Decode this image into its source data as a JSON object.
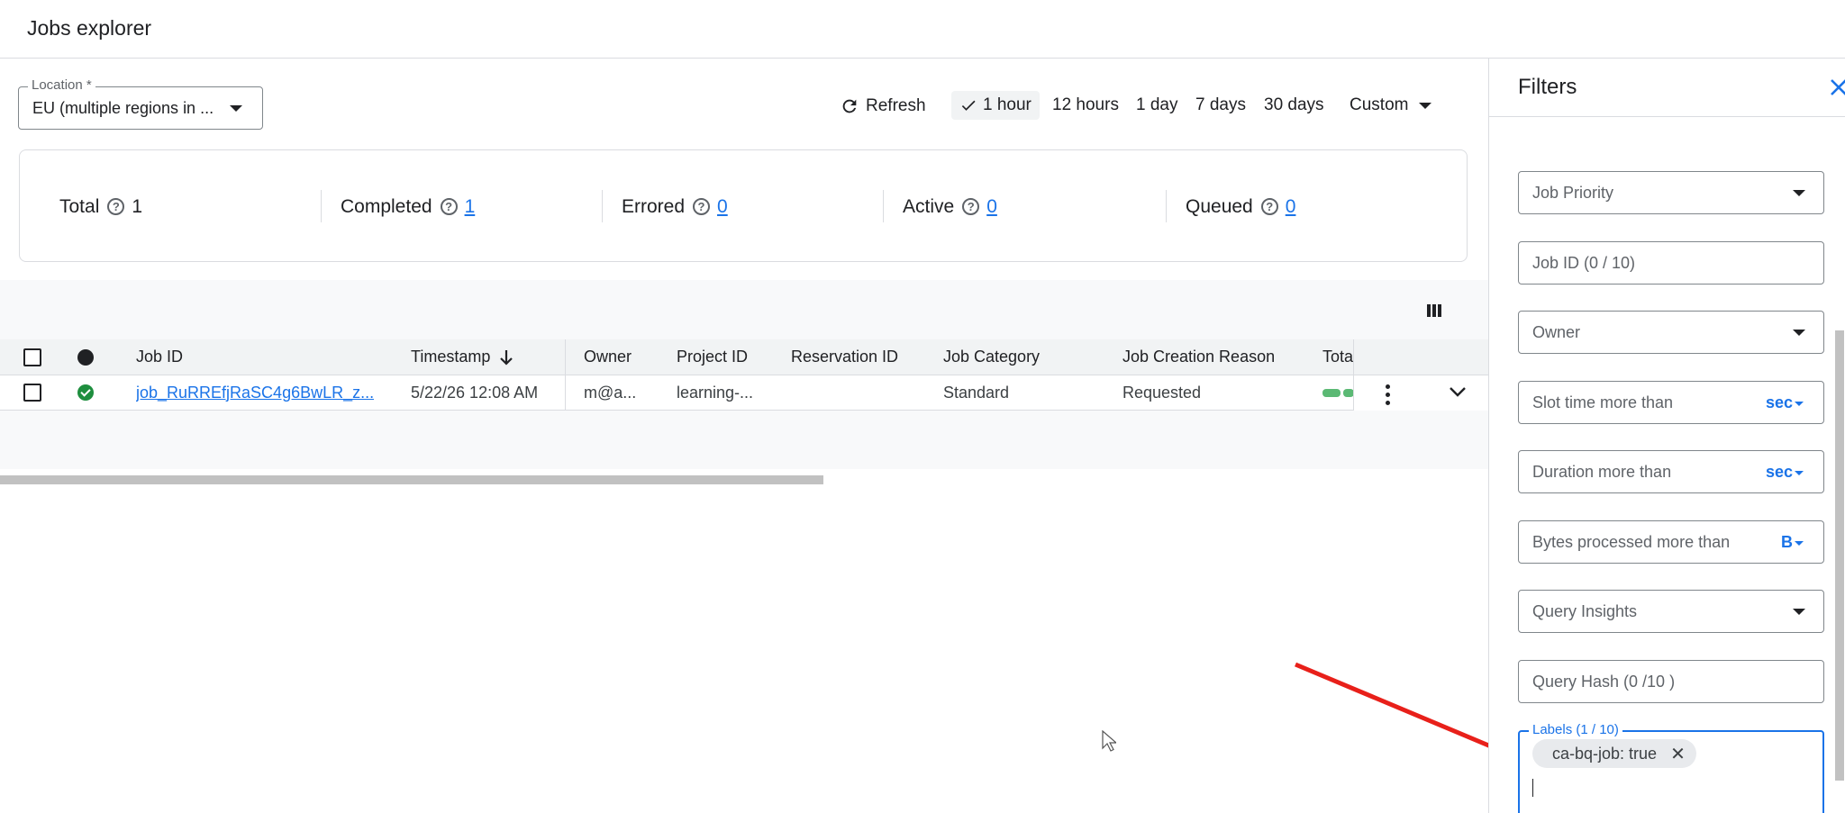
{
  "header": {
    "title": "Jobs explorer"
  },
  "toolbar": {
    "location_label": "Location *",
    "location_value": "EU (multiple regions in ...",
    "refresh_label": "Refresh",
    "ranges": [
      "1 hour",
      "12 hours",
      "1 day",
      "7 days",
      "30 days"
    ],
    "selected_range": "1 hour",
    "custom_label": "Custom"
  },
  "stats": {
    "total_label": "Total",
    "total_value": "1",
    "completed_label": "Completed",
    "completed_value": "1",
    "errored_label": "Errored",
    "errored_value": "0",
    "active_label": "Active",
    "active_value": "0",
    "queued_label": "Queued",
    "queued_value": "0"
  },
  "table": {
    "columns": [
      "Job ID",
      "Timestamp",
      "Owner",
      "Project ID",
      "Reservation ID",
      "Job Category",
      "Job Creation Reason",
      "Tota"
    ],
    "rows": [
      {
        "job_id": "job_RuRREfjRaSC4g6BwLR_z...",
        "timestamp": "5/22/26 12:08 AM",
        "owner": "m@a...",
        "project_id": "learning-...",
        "reservation_id": "",
        "job_category": "Standard",
        "job_creation_reason": "Requested"
      }
    ]
  },
  "filters": {
    "title": "Filters",
    "job_priority": "Job Priority",
    "job_id": "Job ID (0 / 10)",
    "owner": "Owner",
    "slot_time": "Slot time more than",
    "slot_unit": "sec",
    "duration": "Duration more than",
    "duration_unit": "sec",
    "bytes": "Bytes processed more than",
    "bytes_unit": "B",
    "query_insights": "Query Insights",
    "query_hash": "Query Hash (0 /10 )",
    "labels_legend": "Labels (1 / 10)",
    "label_chip": "ca-bq-job: true"
  },
  "colors": {
    "accent": "#1a73e8",
    "success": "#1e8e3e",
    "annotation_arrow": "#e8201a"
  }
}
